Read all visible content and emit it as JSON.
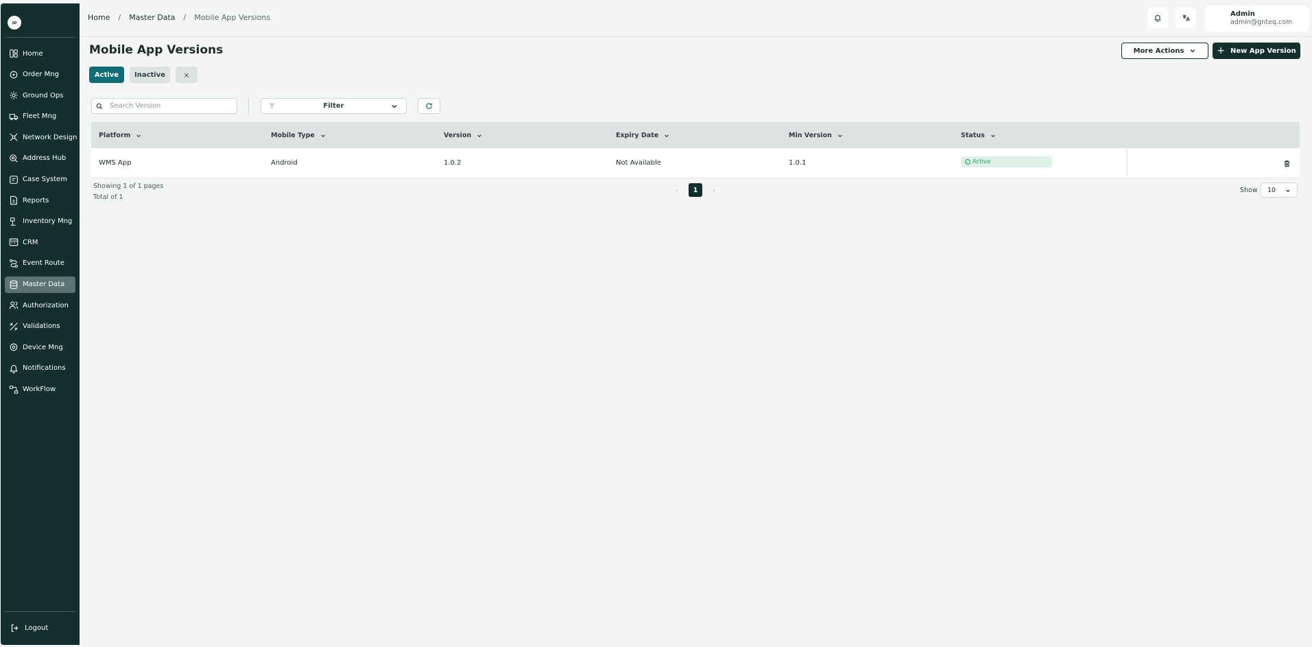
{
  "sidebar": {
    "logo": "∞",
    "items": [
      {
        "label": "Home",
        "icon": "home-icon"
      },
      {
        "label": "Order Mng",
        "icon": "order-icon"
      },
      {
        "label": "Ground Ops",
        "icon": "ground-ops-icon"
      },
      {
        "label": "Fleet Mng",
        "icon": "truck-icon"
      },
      {
        "label": "Network Design",
        "icon": "network-icon"
      },
      {
        "label": "Address Hub",
        "icon": "location-icon"
      },
      {
        "label": "Case System",
        "icon": "case-icon"
      },
      {
        "label": "Reports",
        "icon": "report-icon"
      },
      {
        "label": "Inventory Mng",
        "icon": "inventory-icon"
      },
      {
        "label": "CRM",
        "icon": "crm-icon"
      },
      {
        "label": "Event Route",
        "icon": "route-icon"
      },
      {
        "label": "Master Data",
        "icon": "database-icon",
        "active": true
      },
      {
        "label": "Authorization",
        "icon": "users-icon"
      },
      {
        "label": "Validations",
        "icon": "validation-icon"
      },
      {
        "label": "Device Mng",
        "icon": "device-icon"
      },
      {
        "label": "Notifications",
        "icon": "bell-icon"
      },
      {
        "label": "WorkFlow",
        "icon": "workflow-icon"
      }
    ],
    "logout": "Logout"
  },
  "header": {
    "breadcrumb": [
      "Home",
      "Master Data",
      "Mobile App Versions"
    ],
    "user": {
      "name": "Admin",
      "email": "admin@gnteq.com"
    }
  },
  "page": {
    "title": "Mobile App Versions",
    "more_actions": "More Actions",
    "new_button": "New App Version",
    "tabs": {
      "active": "Active",
      "inactive": "Inactive",
      "close": "×"
    }
  },
  "toolbar": {
    "search_placeholder": "Search Version",
    "filter_label": "Filter"
  },
  "table": {
    "columns": [
      "Platform",
      "Mobile Type",
      "Version",
      "Expiry Date",
      "Min Version",
      "Status"
    ],
    "rows": [
      {
        "platform": "WMS App",
        "mobile_type": "Android",
        "version": "1.0.2",
        "expiry_date": "Not Available",
        "min_version": "1.0.1",
        "status": "Active"
      }
    ]
  },
  "pagination": {
    "showing": "Showing 1 of 1 pages",
    "total": "Total of 1",
    "current_page": "1",
    "show_label": "Show",
    "page_size": "10"
  },
  "colors": {
    "sidebar": "#13302e",
    "accent": "#0f6d75",
    "status_active": "#2a9a6a"
  }
}
